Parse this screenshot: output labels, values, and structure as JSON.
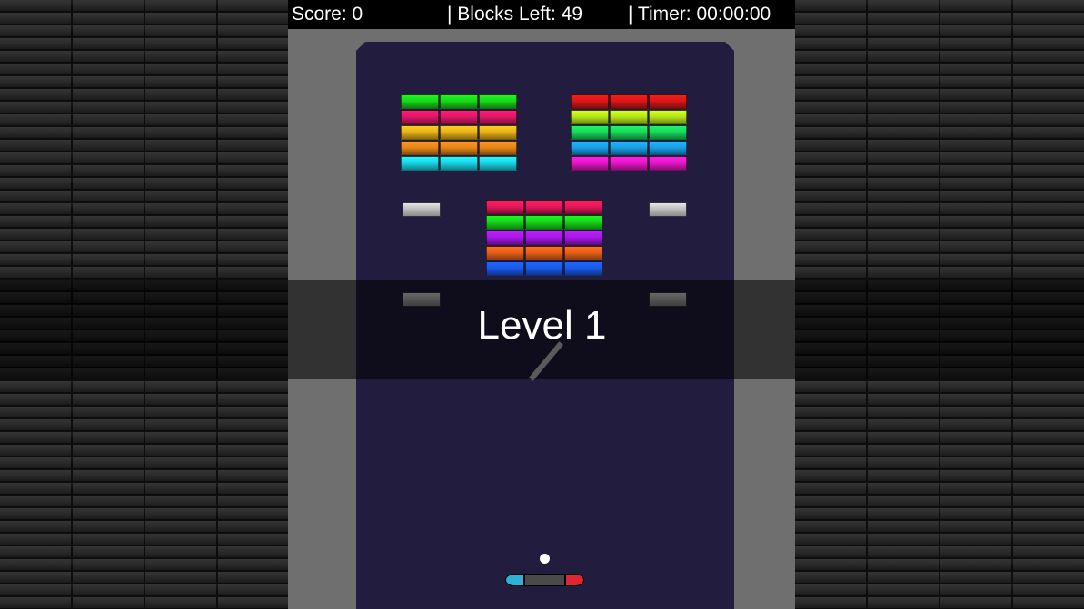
{
  "hud": {
    "score_text": "Score: 0",
    "blocks_text": "| Blocks Left: 49",
    "timer_text": "| Timer: 00:00:00"
  },
  "overlay": {
    "level_text": "Level 1"
  },
  "brick_groups": [
    {
      "name": "top-left",
      "rows": [
        "#18d81a",
        "#e2186a",
        "#e8b21a",
        "#e8861a",
        "#1ad8e8"
      ],
      "cols": 3
    },
    {
      "name": "top-right",
      "rows": [
        "#d81818",
        "#b8e81a",
        "#18d85a",
        "#1aa0e8",
        "#e818c8"
      ],
      "cols": 3
    },
    {
      "name": "center",
      "rows": [
        "#e8185a",
        "#18d81a",
        "#a818e8",
        "#e8601a",
        "#1a5ae8"
      ],
      "cols": 3
    }
  ],
  "colors": {
    "board": "#221c3e",
    "arena": "#6f6f6f",
    "paddle_left": "#2ab3d6",
    "paddle_right": "#e0262e"
  }
}
